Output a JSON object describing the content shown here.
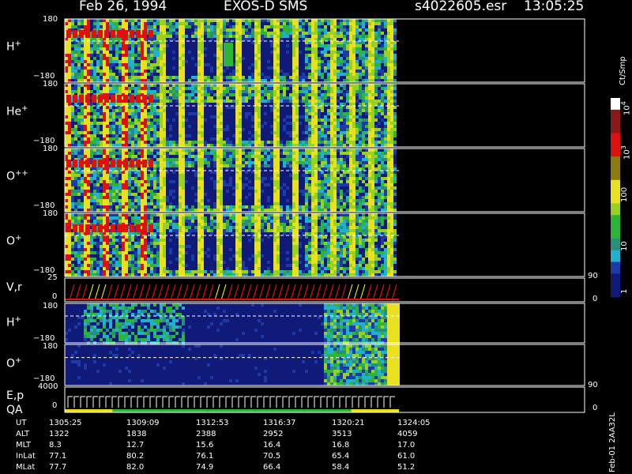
{
  "header": {
    "date": "Feb 26, 1994",
    "instrument": "EXOS-D SMS",
    "file": "s4022605.esr",
    "time": "13:05:25"
  },
  "colors": {
    "low": "#101a78",
    "blue": "#1d3aa8",
    "cyan": "#20b0d0",
    "teal": "#2a8f7a",
    "green": "#2db53a",
    "lime": "#9ad020",
    "yellow": "#e8e020",
    "olive": "#8a7a10",
    "red": "#e01010",
    "darkred": "#8a1a1a",
    "white": "#ffffff",
    "gray": "#555555"
  },
  "colorbar": {
    "unit": "Ct/Smp",
    "labels": [
      {
        "text": "1",
        "value": 1
      },
      {
        "text": "10",
        "value": 10
      },
      {
        "text": "100",
        "value": 100
      },
      {
        "text": "10",
        "sup": "3",
        "value": 1000
      },
      {
        "text": "10",
        "sup": "4",
        "value": 10000
      }
    ]
  },
  "panels": [
    {
      "id": "h-plus",
      "label": "H",
      "sup": "+",
      "ymax": "180",
      "ymin": "−180",
      "kind": "pitch",
      "stop": 0.7
    },
    {
      "id": "he-plus",
      "label": "He",
      "sup": "+",
      "ymax": "180",
      "ymin": "−180",
      "kind": "pitch",
      "stop": 0.7
    },
    {
      "id": "o-plus-plus",
      "label": "O",
      "sup": "++",
      "ymax": "180",
      "ymin": "−180",
      "kind": "pitch",
      "stop": 0.7
    },
    {
      "id": "o-plus",
      "label": "O",
      "sup": "+",
      "ymax": "180",
      "ymin": "−180",
      "kind": "pitch",
      "stop": 0.7
    },
    {
      "id": "vr",
      "label": "V,r",
      "ymax": "25",
      "ymin": "0",
      "right_top": "90",
      "right_bottom": "0",
      "kind": "sweep"
    },
    {
      "id": "h-plus-2",
      "label": "H",
      "sup": "+",
      "ymax": "180",
      "ymin": "−180",
      "kind": "dark"
    },
    {
      "id": "o-plus-2",
      "label": "O",
      "sup": "+",
      "ymax": "180",
      "ymin": "−180",
      "kind": "dark"
    },
    {
      "id": "ep-qa",
      "label": "E,p",
      "label2": "QA",
      "ymax": "4000",
      "ymin": "0",
      "right_top": "90",
      "right_bottom": "0",
      "kind": "steps"
    }
  ],
  "table": {
    "rows": [
      {
        "name": "UT",
        "values": [
          "1305:25",
          "1309:09",
          "1312:53",
          "1316:37",
          "1320:21",
          "1324:05"
        ]
      },
      {
        "name": "ALT",
        "values": [
          "1322",
          "1838",
          "2388",
          "2952",
          "3513",
          "4059"
        ]
      },
      {
        "name": "MLT",
        "values": [
          "8.3",
          "12.7",
          "15.6",
          "16.4",
          "16.8",
          "17.0"
        ]
      },
      {
        "name": "InLat",
        "values": [
          "77.1",
          "80.2",
          "76.1",
          "70.5",
          "65.4",
          "61.0"
        ]
      },
      {
        "name": "MLat",
        "values": [
          "77.7",
          "82.0",
          "74.9",
          "66.4",
          "58.4",
          "51.2"
        ]
      }
    ]
  },
  "footer_vertical": "Feb-01 2AA32L"
}
